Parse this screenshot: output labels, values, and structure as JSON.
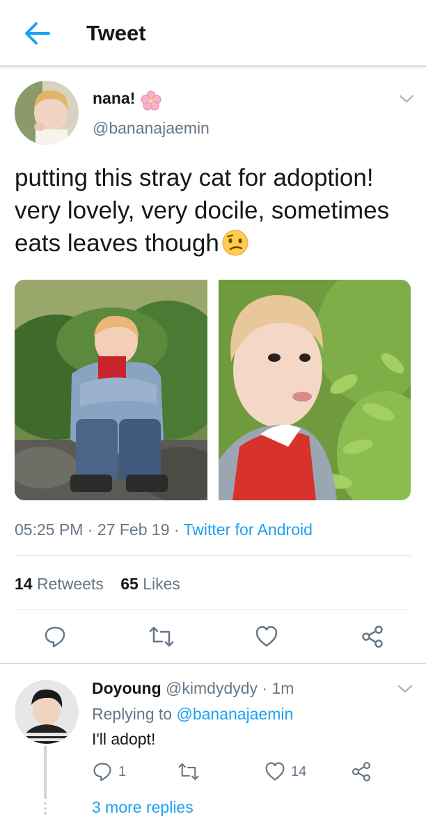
{
  "header": {
    "title": "Tweet",
    "back_icon": "arrow-left-icon"
  },
  "tweet": {
    "author_name": "nana!",
    "author_handle": "@bananajaemin",
    "text": "putting this stray cat for adoption! very lovely, very docile, sometimes eats leaves though",
    "emoji": "confused-face-emoji",
    "time": "05:25 PM",
    "date": "27 Feb 19",
    "source": "Twitter for Android",
    "retweets_count": "14",
    "retweets_label": "Retweets",
    "likes_count": "65",
    "likes_label": "Likes",
    "media": [
      "photo-sitting-by-bushes",
      "photo-eating-leaves"
    ]
  },
  "reply": {
    "author_name": "Doyoung",
    "author_handle": "@kimdydydy",
    "time": "1m",
    "replying_prefix": "Replying to",
    "replying_to": "@bananajaemin",
    "text": "I'll adopt!",
    "reply_count": "1",
    "retweet_count": "",
    "like_count": "14",
    "more_replies": "3 more replies"
  },
  "colors": {
    "accent": "#1da1f2",
    "muted": "#657786",
    "text": "#14171a",
    "divider": "#e1e8ed"
  }
}
